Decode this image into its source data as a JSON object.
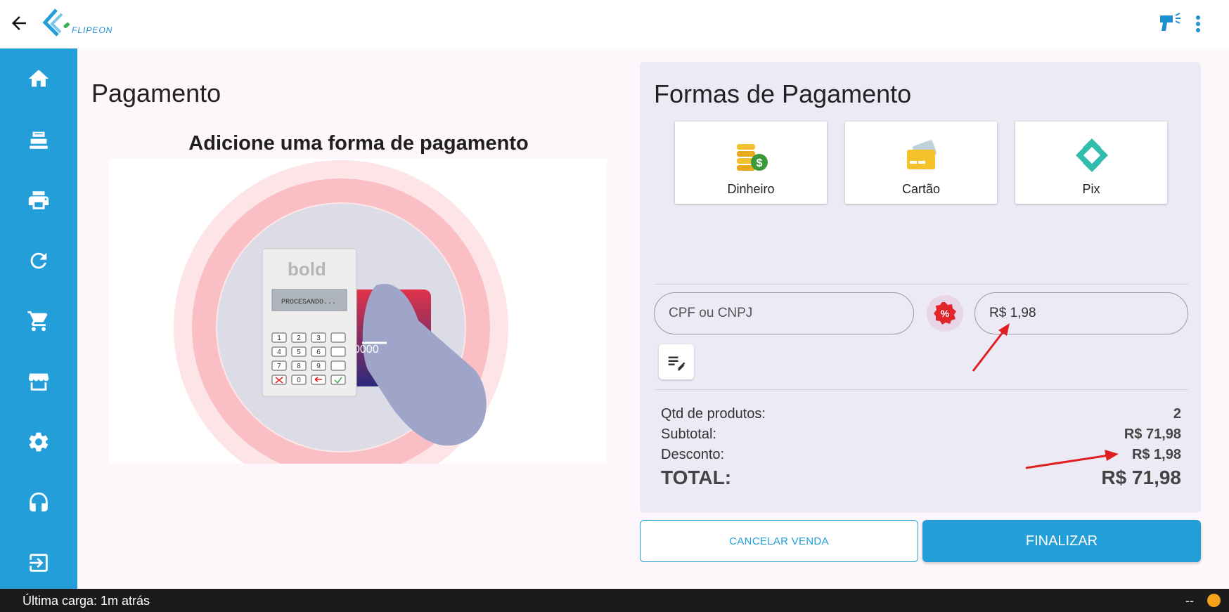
{
  "app": {
    "logo_text": "FLIPEON"
  },
  "topbar": {
    "back_icon": "arrow-left-icon",
    "scanner_icon": "barcode-scanner-icon",
    "menu_icon": "more-vert-icon"
  },
  "sidebar": {
    "items": [
      {
        "name": "home",
        "icon": "home-icon"
      },
      {
        "name": "cash-register",
        "icon": "cash-register-icon"
      },
      {
        "name": "print",
        "icon": "printer-icon"
      },
      {
        "name": "refresh",
        "icon": "refresh-icon"
      },
      {
        "name": "cart",
        "icon": "cart-icon"
      },
      {
        "name": "store",
        "icon": "store-icon"
      },
      {
        "name": "settings",
        "icon": "gear-icon"
      },
      {
        "name": "support",
        "icon": "headset-icon"
      },
      {
        "name": "logout",
        "icon": "logout-icon"
      }
    ]
  },
  "main": {
    "title": "Pagamento",
    "subtitle": "Adicione uma forma de pagamento",
    "terminal": {
      "brand": "bold",
      "screen_text": "PROCESANDO...",
      "card_digits": "0000"
    }
  },
  "payment": {
    "title": "Formas de Pagamento",
    "methods": [
      {
        "label": "Dinheiro",
        "icon": "money-coins-icon"
      },
      {
        "label": "Cartão",
        "icon": "credit-card-icon"
      },
      {
        "label": "Pix",
        "icon": "pix-icon"
      }
    ],
    "cpf_placeholder": "CPF ou CNPJ",
    "discount_value": "R$ 1,98",
    "summary": {
      "qtd_label": "Qtd de produtos:",
      "qtd_value": "2",
      "subtotal_label": "Subtotal:",
      "subtotal_value": "R$ 71,98",
      "desconto_label": "Desconto:",
      "desconto_value": "R$ 1,98",
      "total_label": "TOTAL:",
      "total_value": "R$ 71,98"
    },
    "cancel_label": "CANCELAR VENDA",
    "finish_label": "FINALIZAR"
  },
  "status": {
    "text": "Última carga: 1m atrás",
    "right_text": "--"
  },
  "colors": {
    "primary": "#239ed9",
    "annotation_red": "#e02020",
    "status_dot": "#f7a21b"
  }
}
